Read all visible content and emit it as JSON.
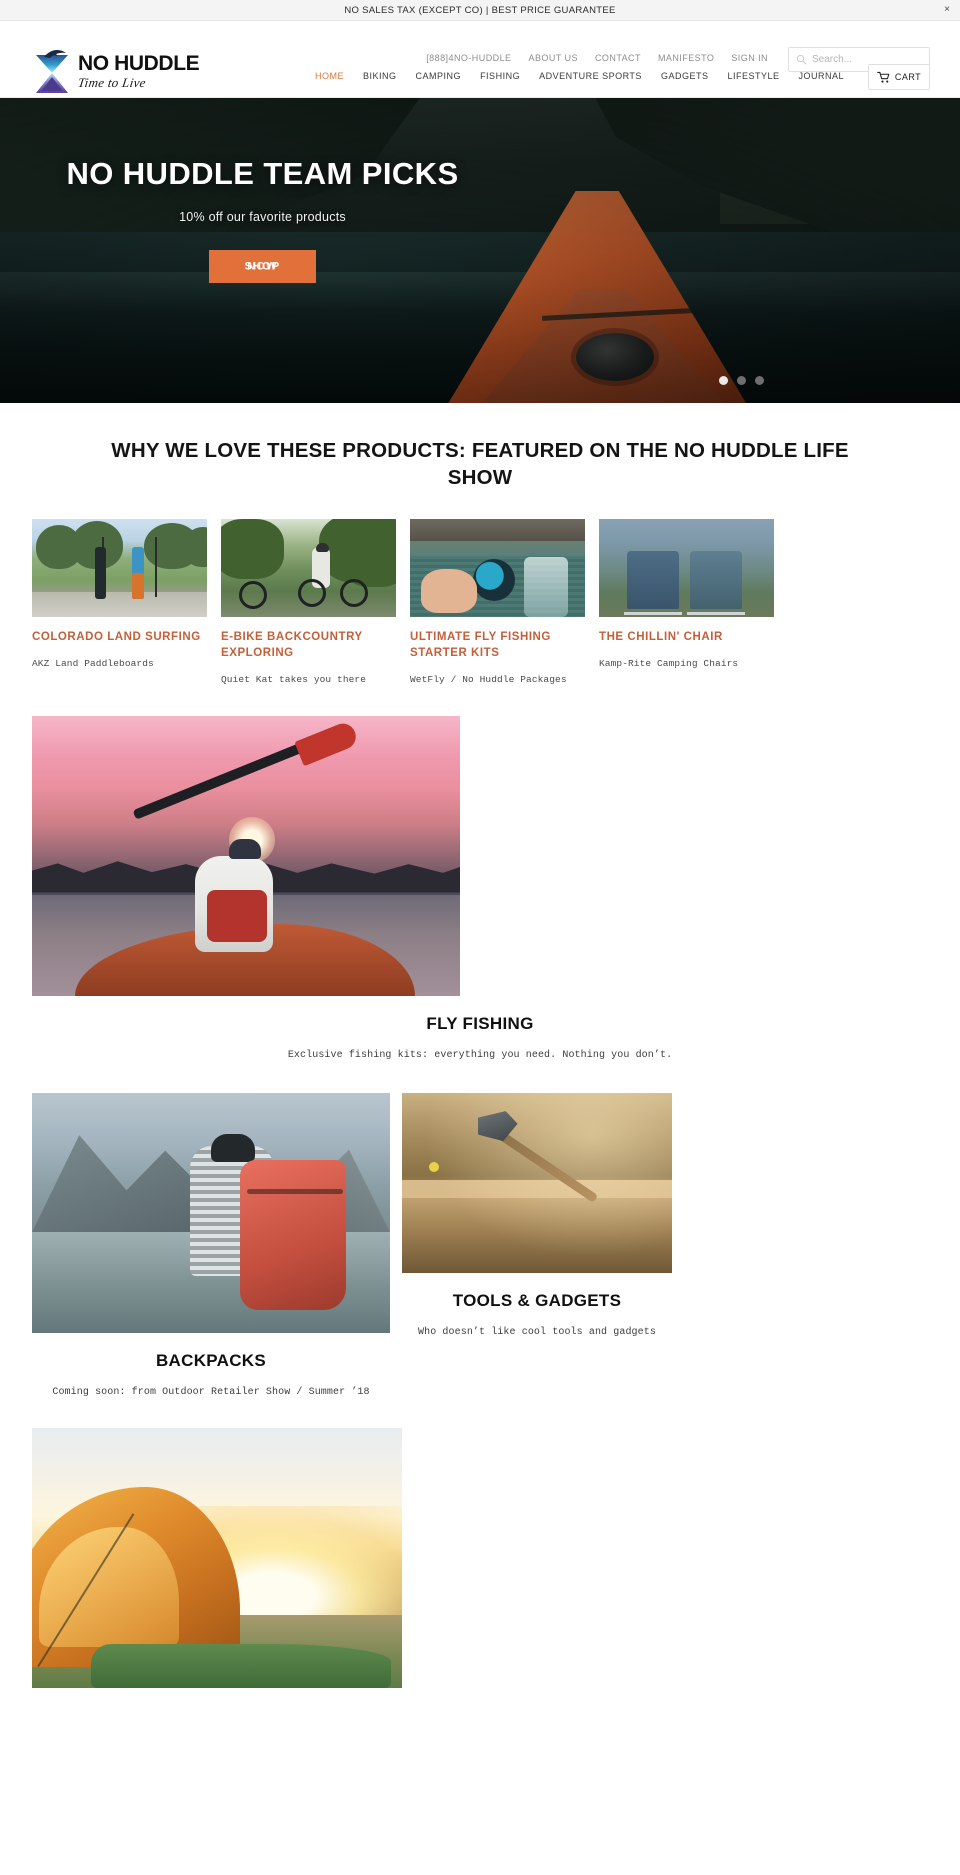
{
  "announcement": {
    "text": "NO SALES TAX (EXCEPT CO) | BEST PRICE GUARANTEE",
    "close_label": "×"
  },
  "brand": {
    "name": "NO HUDDLE",
    "tagline": "Time to Live"
  },
  "utility_nav": [
    {
      "label": "[888]4NO-HUDDLE"
    },
    {
      "label": "ABOUT US"
    },
    {
      "label": "CONTACT"
    },
    {
      "label": "MANIFESTO"
    },
    {
      "label": "SIGN IN"
    }
  ],
  "search": {
    "placeholder": "Search...",
    "value": "",
    "icon": "search-icon"
  },
  "main_nav": [
    {
      "label": "HOME",
      "active": true
    },
    {
      "label": "BIKING",
      "active": false
    },
    {
      "label": "CAMPING",
      "active": false
    },
    {
      "label": "FISHING",
      "active": false
    },
    {
      "label": "ADVENTURE SPORTS",
      "active": false
    },
    {
      "label": "GADGETS",
      "active": false
    },
    {
      "label": "LIFESTYLE",
      "active": false
    },
    {
      "label": "JOURNAL",
      "active": false
    }
  ],
  "cart": {
    "label": "CART",
    "icon": "shopping-cart-icon"
  },
  "hero": {
    "title": "NO HUDDLE TEAM PICKS",
    "subtitle": "10% off our favorite products",
    "cta_primary": "SHOP",
    "cta_secondary": "NOW",
    "cta_color": "#e2703a",
    "slides": [
      {
        "active": true
      },
      {
        "active": false
      },
      {
        "active": false
      }
    ]
  },
  "featured": {
    "heading": "WHY WE LOVE THESE PRODUCTS: FEATURED ON THE NO HUDDLE LIFE SHOW",
    "title_color": "#c2603a",
    "cards": [
      {
        "title": "COLORADO LAND SURFING",
        "subtitle": "AKZ Land Paddleboards",
        "image": "two-people-with-land-paddleboards-in-park"
      },
      {
        "title": "E-BIKE BACKCOUNTRY EXPLORING",
        "subtitle": "Quiet Kat takes you there",
        "image": "cyclist-on-ebike-in-forest"
      },
      {
        "title": "ULTIMATE FLY FISHING STARTER KITS",
        "subtitle": "WetFly / No Huddle Packages",
        "image": "hand-holding-fly-fishing-reel-over-river"
      },
      {
        "title": "THE CHILLIN' CHAIR",
        "subtitle": "Kamp-Rite Camping Chairs",
        "image": "two-camping-chairs-by-lake"
      }
    ]
  },
  "categories": [
    {
      "title": "FLY FISHING",
      "subtitle": "Exclusive fishing kits: everything you need. Nothing you don’t.",
      "image": "kayaker-paddling-at-sunset"
    },
    {
      "title": "BACKPACKS",
      "subtitle": "Coming soon: from Outdoor Retailer Show / Summer ’18",
      "image": "hiker-with-red-backpack-at-mountain-lake"
    },
    {
      "title": "TOOLS & GADGETS",
      "subtitle": "Who doesn’t like cool tools and gadgets",
      "image": "axe-stuck-in-log"
    },
    {
      "title": "",
      "subtitle": "",
      "image": "tent-at-sunrise-on-hillside"
    }
  ]
}
